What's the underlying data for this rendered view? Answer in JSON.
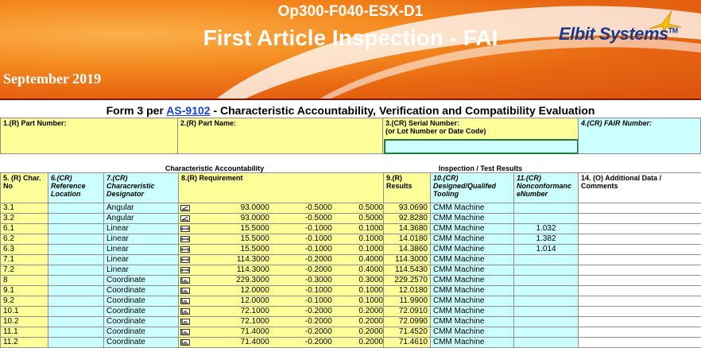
{
  "banner": {
    "doc_code": "Op300-F040-ESX-D1",
    "title": "First Article Inspection - FAI",
    "date": "September 2019",
    "logo_text": "Elbit Systems",
    "logo_tm": "TM"
  },
  "form": {
    "title_prefix": "Form 3 per ",
    "title_link": "AS-9102",
    "title_suffix": " - Characteristic Accountability, Verification and Compatibility Evaluation"
  },
  "fields": {
    "part_number": "1.(R) Part Number:",
    "part_name": "2.(R) Part Name:",
    "serial_number_1": "3.(CR) Serial Number:",
    "serial_number_2": "(or Lot Number or Date Code)",
    "fair_number": "4.(CR) FAIR Number:"
  },
  "groups": {
    "char_acc": "Characteristic Accountability",
    "inspection": "Inspection / Test Results"
  },
  "columns": {
    "c5": "5. (R) Char. No",
    "c6": "6.(CR) Reference Location",
    "c7": "7.(CR) Characreristic Designator",
    "c8": "8.(R) Requirement",
    "c9": "9.(R) Results",
    "c10": "10.(CR) Designed/Qualifed Tooling",
    "c11": "11.(CR) Nonconformanc eNumber",
    "c14": "14. (O) Additional Data / Comments"
  },
  "rows": [
    {
      "no": "3.1",
      "designator": "Angular",
      "icon": "angularity-icon",
      "nominal": "93.0000",
      "lower": "-0.5000",
      "upper": "0.5000",
      "result": "93.0690",
      "tooling": "CMM Machine",
      "ncr": ""
    },
    {
      "no": "3.2",
      "designator": "Angular",
      "icon": "angularity-icon",
      "nominal": "93.0000",
      "lower": "-0.5000",
      "upper": "0.5000",
      "result": "92.8280",
      "tooling": "CMM Machine",
      "ncr": ""
    },
    {
      "no": "6.1",
      "designator": "Linear",
      "icon": "linear-icon",
      "nominal": "15.5000",
      "lower": "-0.1000",
      "upper": "0.1000",
      "result": "14.3680",
      "tooling": "CMM Machine",
      "ncr": "1.032"
    },
    {
      "no": "6.2",
      "designator": "Linear",
      "icon": "linear-icon",
      "nominal": "15.5000",
      "lower": "-0.1000",
      "upper": "0.1000",
      "result": "14.0180",
      "tooling": "CMM Machine",
      "ncr": "1.382"
    },
    {
      "no": "6.3",
      "designator": "Linear",
      "icon": "linear-icon",
      "nominal": "15.5000",
      "lower": "-0.1000",
      "upper": "0.1000",
      "result": "14.3860",
      "tooling": "CMM Machine",
      "ncr": "1.014"
    },
    {
      "no": "7.1",
      "designator": "Linear",
      "icon": "linear-icon",
      "nominal": "114.3000",
      "lower": "-0.2000",
      "upper": "0.4000",
      "result": "114.3000",
      "tooling": "CMM Machine",
      "ncr": ""
    },
    {
      "no": "7.2",
      "designator": "Linear",
      "icon": "linear-icon",
      "nominal": "114.3000",
      "lower": "-0.2000",
      "upper": "0.4000",
      "result": "114.5430",
      "tooling": "CMM Machine",
      "ncr": ""
    },
    {
      "no": "8",
      "designator": "Coordinate",
      "icon": "coordinate-icon",
      "nominal": "229.3000",
      "lower": "-0.3000",
      "upper": "0.3000",
      "result": "229.2570",
      "tooling": "CMM Machine",
      "ncr": ""
    },
    {
      "no": "9.1",
      "designator": "Coordinate",
      "icon": "coordinate-icon",
      "nominal": "12.0000",
      "lower": "-0.1000",
      "upper": "0.1000",
      "result": "12.0180",
      "tooling": "CMM Machine",
      "ncr": ""
    },
    {
      "no": "9.2",
      "designator": "Coordinate",
      "icon": "coordinate-icon",
      "nominal": "12.0000",
      "lower": "-0.1000",
      "upper": "0.1000",
      "result": "11.9900",
      "tooling": "CMM Machine",
      "ncr": ""
    },
    {
      "no": "10.1",
      "designator": "Coordinate",
      "icon": "coordinate-icon",
      "nominal": "72.1000",
      "lower": "-0.2000",
      "upper": "0.2000",
      "result": "72.0910",
      "tooling": "CMM Machine",
      "ncr": ""
    },
    {
      "no": "10.2",
      "designator": "Coordinate",
      "icon": "coordinate-icon",
      "nominal": "72.1000",
      "lower": "-0.2000",
      "upper": "0.2000",
      "result": "72.0990",
      "tooling": "CMM Machine",
      "ncr": ""
    },
    {
      "no": "11.1",
      "designator": "Coordinate",
      "icon": "coordinate-icon",
      "nominal": "71.4000",
      "lower": "-0.2000",
      "upper": "0.2000",
      "result": "71.4520",
      "tooling": "CMM Machine",
      "ncr": ""
    },
    {
      "no": "11.2",
      "designator": "Coordinate",
      "icon": "coordinate-icon",
      "nominal": "71.4000",
      "lower": "-0.2000",
      "upper": "0.2000",
      "result": "71.4610",
      "tooling": "CMM Machine",
      "ncr": ""
    }
  ],
  "colors": {
    "yellow": "#ffff99",
    "cyan": "#ccffff",
    "banner_orange": "#f58a1f",
    "logo_blue": "#1a3a8c"
  }
}
